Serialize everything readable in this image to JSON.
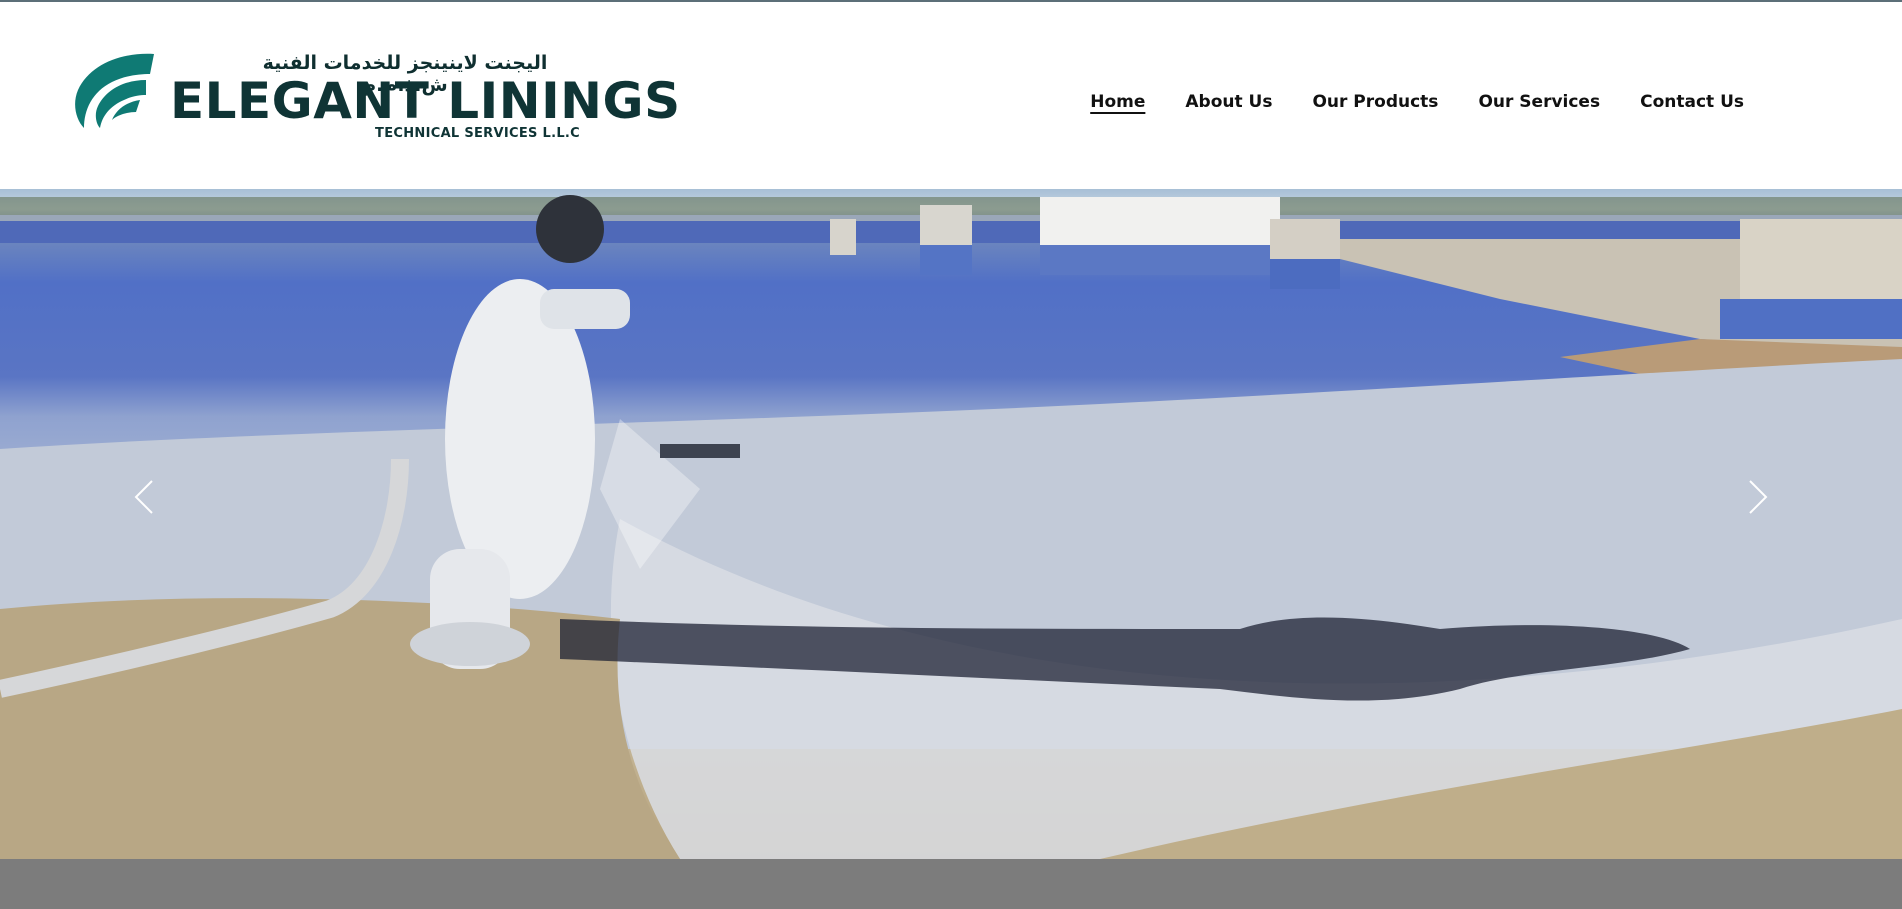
{
  "brand": {
    "arabic_name": "اليجنت لاينينجز للخدمات الفنية ش.ذ.م.م",
    "name": "ELEGANT LININGS",
    "subtitle": "TECHNICAL SERVICES L.L.C",
    "primary_color": "#0f3435",
    "mark_color": "#0f7a74"
  },
  "nav": {
    "items": [
      {
        "label": "Home",
        "active": true
      },
      {
        "label": "About Us",
        "active": false
      },
      {
        "label": "Our Products",
        "active": false
      },
      {
        "label": "Our Services",
        "active": false
      },
      {
        "label": "Contact Us",
        "active": false
      }
    ]
  },
  "hero": {
    "prev_icon": "chevron-left-icon",
    "next_icon": "chevron-right-icon"
  },
  "colors": {
    "footer_band": "#7c7c7c",
    "top_rule": "#5c6f78"
  }
}
